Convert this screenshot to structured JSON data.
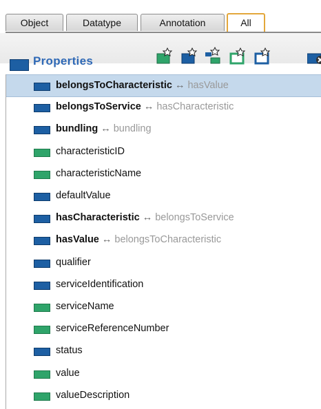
{
  "tabs": [
    {
      "label": "Object"
    },
    {
      "label": "Datatype"
    },
    {
      "label": "Annotation"
    },
    {
      "label": "All"
    }
  ],
  "header": {
    "title": "Properties"
  },
  "toolbar": {
    "icons": [
      "add-property-icon",
      "add-subproperty-icon",
      "add-hierarchy-icon",
      "add-sibling-icon",
      "add-child-icon",
      "delete-property-icon"
    ]
  },
  "colors": {
    "object_property": "#1d5fa3",
    "datatype_property": "#2fa46a",
    "selected_row": "#c5d9ec",
    "active_tab_border": "#e3a73a"
  },
  "properties": [
    {
      "name": "belongsToCharacteristic",
      "kind": "object",
      "inverse": "hasValue",
      "selected": true
    },
    {
      "name": "belongsToService",
      "kind": "object",
      "inverse": "hasCharacteristic"
    },
    {
      "name": "bundling",
      "kind": "object",
      "inverse": "bundling"
    },
    {
      "name": "characteristicID",
      "kind": "datatype"
    },
    {
      "name": "characteristicName",
      "kind": "datatype"
    },
    {
      "name": "defaultValue",
      "kind": "object"
    },
    {
      "name": "hasCharacteristic",
      "kind": "object",
      "inverse": "belongsToService"
    },
    {
      "name": "hasValue",
      "kind": "object",
      "inverse": "belongsToCharacteristic"
    },
    {
      "name": "qualifier",
      "kind": "object"
    },
    {
      "name": "serviceIdentification",
      "kind": "object"
    },
    {
      "name": "serviceName",
      "kind": "datatype"
    },
    {
      "name": "serviceReferenceNumber",
      "kind": "datatype"
    },
    {
      "name": "status",
      "kind": "object"
    },
    {
      "name": "value",
      "kind": "datatype"
    },
    {
      "name": "valueDescription",
      "kind": "datatype"
    }
  ]
}
